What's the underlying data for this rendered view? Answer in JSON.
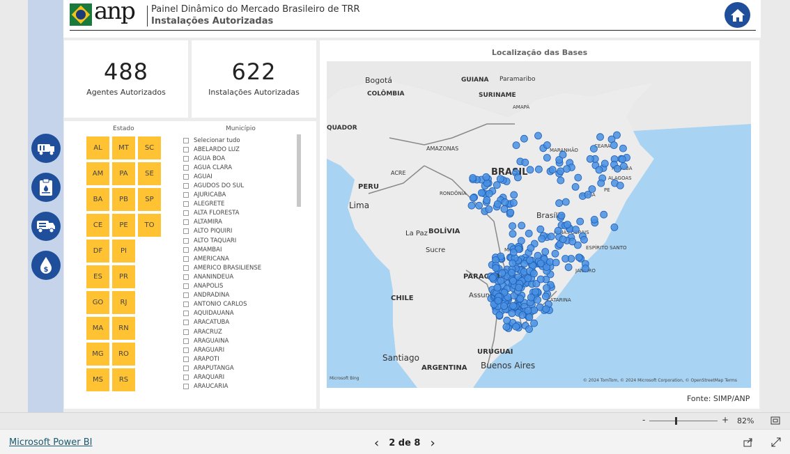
{
  "header": {
    "title_line1": "Painel Dinâmico do Mercado Brasileiro de TRR",
    "title_line2": "Instalações Autorizadas",
    "logo_text": "anp"
  },
  "kpis": [
    {
      "value": "488",
      "label": "Agentes Autorizados"
    },
    {
      "value": "622",
      "label": "Instalações Autorizadas"
    }
  ],
  "slicers": {
    "estado_label": "Estado",
    "municipio_label": "Município",
    "estados": [
      "AL",
      "MT",
      "SC",
      "AM",
      "PA",
      "SE",
      "BA",
      "PB",
      "SP",
      "CE",
      "PE",
      "TO",
      "DF",
      "PI",
      "ES",
      "PR",
      "GO",
      "RJ",
      "MA",
      "RN",
      "MG",
      "RO",
      "MS",
      "RS"
    ],
    "municipios": [
      "Selecionar tudo",
      "ABELARDO LUZ",
      "AGUA BOA",
      "AGUA CLARA",
      "AGUAI",
      "AGUDOS DO SUL",
      "AJURICABA",
      "ALEGRETE",
      "ALTA FLORESTA",
      "ALTAMIRA",
      "ALTO PIQUIRI",
      "ALTO TAQUARI",
      "AMAMBAI",
      "AMERICANA",
      "AMERICO BRASILIENSE",
      "ANANINDEUA",
      "ANAPOLIS",
      "ANDRADINA",
      "ANTONIO CARLOS",
      "AQUIDAUANA",
      "ARACATUBA",
      "ARACRUZ",
      "ARAGUAINA",
      "ARAGUARI",
      "ARAPOTI",
      "ARAPUTANGA",
      "ARAQUARI",
      "ARAUCARIA"
    ]
  },
  "map": {
    "title": "Localização das Bases",
    "labels": [
      "Bogotá",
      "GUIANA",
      "Paramaribo",
      "COLÔMBIA",
      "SURINAME",
      "AMAPÁ",
      "QUADOR",
      "AMAZONAS",
      "MARANHÃO",
      "CEARÁ",
      "BRASIL",
      "ACRE",
      "PARAÍBA",
      "ALAGOAS",
      "PERU",
      "RONDÔNIA",
      "PE",
      "BAHIA",
      "Lima",
      "Brasília",
      "BOLÍVIA",
      "La Paz",
      "MINAS GERAIS",
      "Sucre",
      "ESPÍRITO SANTO",
      "MATO",
      "JANEIRO",
      "PARAGUAI",
      "Assunção",
      "CATARINA",
      "CHILE",
      "URUGUAI",
      "Santiago",
      "ARGENTINA",
      "Buenos Aires"
    ],
    "attribution_left": "Microsoft Bing",
    "attribution_right": "© 2024 TomTom, © 2024 Microsoft Corporation, © OpenStreetMap  Terms",
    "point_color": "#4a90e2"
  },
  "source": "Fonte: SIMP/ANP",
  "zoom": {
    "minus": "-",
    "plus": "+",
    "level": "82%"
  },
  "footer": {
    "powerbi": "Microsoft Power BI",
    "page": "2 de 8",
    "prev": "‹",
    "next": "›"
  }
}
